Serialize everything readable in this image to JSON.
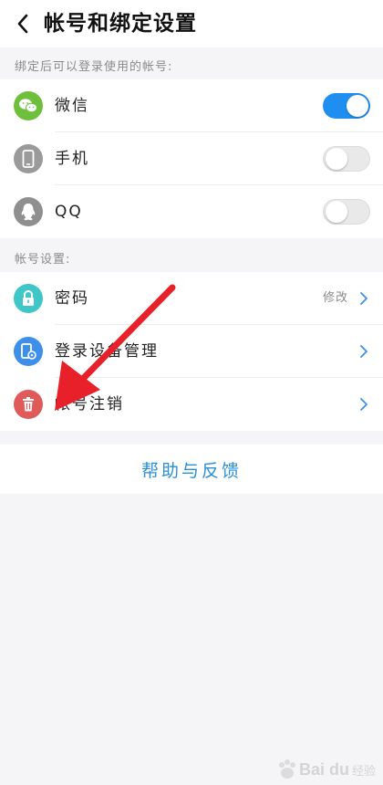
{
  "header": {
    "title": "帐号和绑定设置"
  },
  "bound_section": {
    "label": "绑定后可以登录使用的帐号:",
    "items": [
      {
        "label": "微信",
        "icon": "wechat-icon",
        "icon_color": "#6ebf3b",
        "toggle_on": true
      },
      {
        "label": "手机",
        "icon": "phone-icon",
        "icon_color": "#9a9a9a",
        "toggle_on": false
      },
      {
        "label": "QQ",
        "icon": "qq-icon",
        "icon_color": "#8f8f8f",
        "toggle_on": false
      }
    ]
  },
  "account_section": {
    "label": "帐号设置:",
    "items": [
      {
        "label": "密码",
        "value": "修改",
        "icon": "lock-icon",
        "icon_color": "#3fc6c6"
      },
      {
        "label": "登录设备管理",
        "icon": "device-settings-icon",
        "icon_color": "#3d8fe8"
      },
      {
        "label": "帐号注销",
        "icon": "trash-icon",
        "icon_color": "#e05a5a"
      }
    ]
  },
  "help_link": "帮助与反馈",
  "watermark": {
    "brand": "Bai du",
    "sub": "经验"
  },
  "colors": {
    "accent": "#1f8ef1",
    "link": "#2b8fd6",
    "annotation_arrow": "#e8202a"
  }
}
